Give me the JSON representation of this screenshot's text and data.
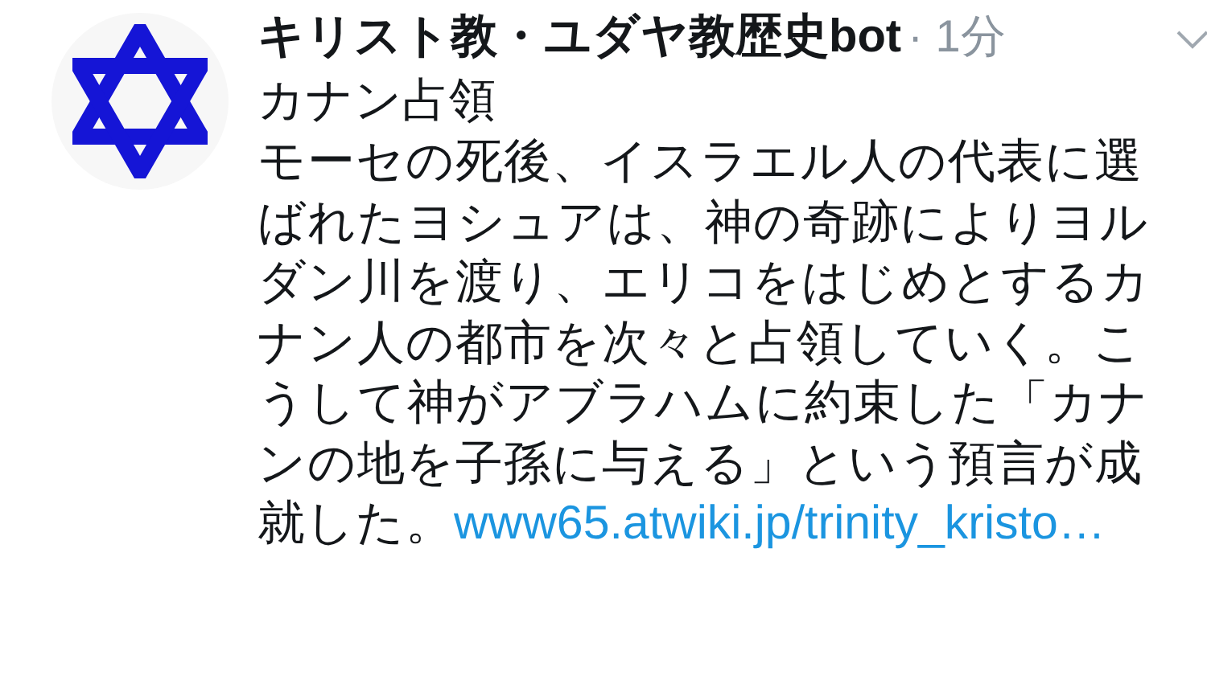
{
  "tweet": {
    "author": "キリスト教・ユダヤ教歴史bot",
    "time": "· 1分",
    "title": "カナン占領",
    "text": "モーセの死後、イスラエル人の代表に選ばれたヨシュアは、神の奇跡によりヨルダン川を渡り、エリコをはじめとするカナン人の都市を次々と占領していく。こうして神がアブラハムに約束した「カナンの地を子孫に与える」という預言が成就した。",
    "link": "www65.atwiki.jp/trinity_kristo…"
  }
}
